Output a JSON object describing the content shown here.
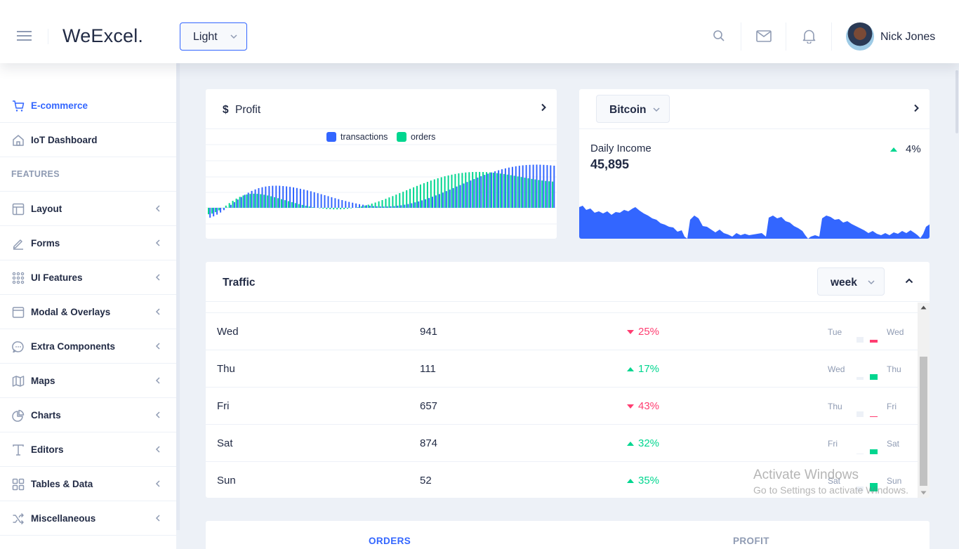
{
  "header": {
    "app_title": "WeExcel.",
    "theme": "Light",
    "user_name": "Nick Jones",
    "icons": [
      "menu-icon",
      "search-icon",
      "email-icon",
      "bell-icon"
    ]
  },
  "sidebar": {
    "items": [
      {
        "label": "E-commerce",
        "icon": "shopping-cart-icon",
        "active": true
      },
      {
        "label": "IoT Dashboard",
        "icon": "home-icon"
      },
      {
        "label": "Layout",
        "icon": "layout-icon"
      },
      {
        "label": "Forms",
        "icon": "edit-icon"
      },
      {
        "label": "UI Features",
        "icon": "keypad-icon"
      },
      {
        "label": "Modal & Overlays",
        "icon": "browser-icon"
      },
      {
        "label": "Extra Components",
        "icon": "message-circle-icon"
      },
      {
        "label": "Maps",
        "icon": "map-icon"
      },
      {
        "label": "Charts",
        "icon": "pie-chart-icon"
      },
      {
        "label": "Editors",
        "icon": "text-icon"
      },
      {
        "label": "Tables & Data",
        "icon": "grid-icon"
      },
      {
        "label": "Miscellaneous",
        "icon": "shuffle-icon"
      }
    ],
    "group_label": "FEATURES"
  },
  "profit_card": {
    "currency_symbol": "$",
    "title": "Profit",
    "legend": [
      {
        "name": "transactions",
        "color": "#3366ff"
      },
      {
        "name": "orders",
        "color": "#00d68f"
      }
    ]
  },
  "bitcoin_card": {
    "currency": "Bitcoin",
    "income_label": "Daily Income",
    "income_value": "45,895",
    "delta": "4%",
    "delta_direction": "up",
    "area_color": "#3366ff"
  },
  "traffic_card": {
    "title": "Traffic",
    "period": "week",
    "rows": [
      {
        "day": "Wed",
        "value": "941",
        "delta": "25%",
        "direction": "down",
        "prev": "Tue",
        "cur": "Wed",
        "prev_level": 0.3,
        "cur_level": 0.15
      },
      {
        "day": "Thu",
        "value": "111",
        "delta": "17%",
        "direction": "up",
        "prev": "Wed",
        "cur": "Thu",
        "prev_level": 0.15,
        "cur_level": 0.3
      },
      {
        "day": "Fri",
        "value": "657",
        "delta": "43%",
        "direction": "down",
        "prev": "Thu",
        "cur": "Fri",
        "prev_level": 0.3,
        "cur_level": 0.03
      },
      {
        "day": "Sat",
        "value": "874",
        "delta": "32%",
        "direction": "up",
        "prev": "Fri",
        "cur": "Sat",
        "prev_level": 0.03,
        "cur_level": 0.25
      },
      {
        "day": "Sun",
        "value": "52",
        "delta": "35%",
        "direction": "up",
        "prev": "Sat",
        "cur": "Sun",
        "prev_level": 0.25,
        "cur_level": 0.45
      }
    ]
  },
  "bottom_tabs": [
    {
      "label": "ORDERS",
      "active": true
    },
    {
      "label": "PROFIT",
      "active": false
    }
  ],
  "watermark": {
    "title": "Activate Windows",
    "subtitle": "Go to Settings to activate Windows."
  },
  "colors": {
    "primary": "#3366ff",
    "success": "#00d68f",
    "danger": "#ff3d71"
  }
}
